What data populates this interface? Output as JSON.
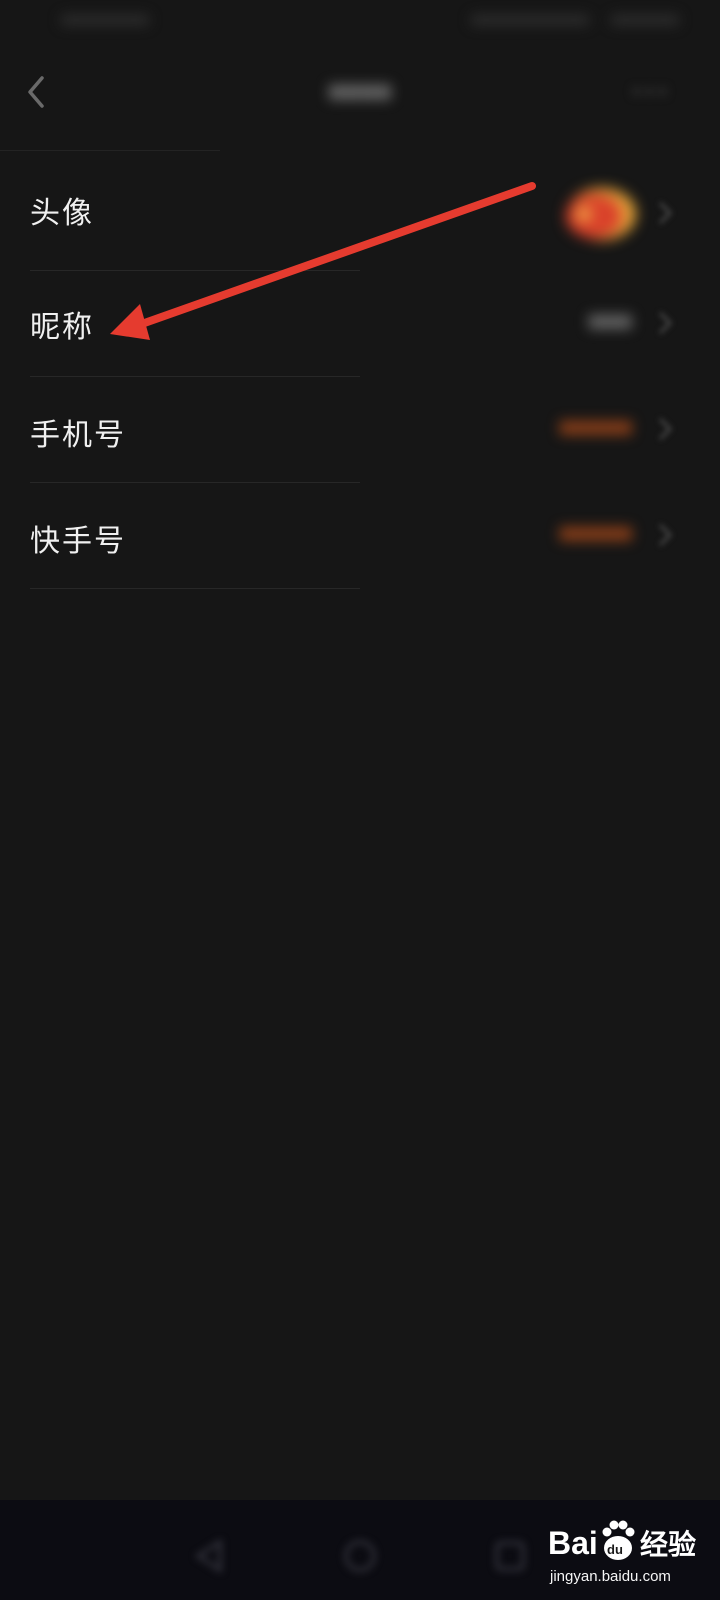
{
  "colors": {
    "background": "#161616",
    "label_text": "#f0f0f0",
    "value_accent": "#c2521a",
    "annotation_arrow": "#e53b2f",
    "avatar_primary": "#d9412a",
    "avatar_secondary": "#e8a83a",
    "bottom_nav": "#0c0c12"
  },
  "icons": {
    "back": "chevron-left-icon",
    "more": "more-dots-icon",
    "row_chevron": "chevron-right-icon",
    "annotation": "red-arrow-annotation"
  },
  "rows": [
    {
      "label": "头像"
    },
    {
      "label": "昵称"
    },
    {
      "label": "手机号"
    },
    {
      "label": "快手号"
    }
  ],
  "watermark": {
    "logo_text": "Baidu经验",
    "url": "jingyan.baidu.com"
  }
}
